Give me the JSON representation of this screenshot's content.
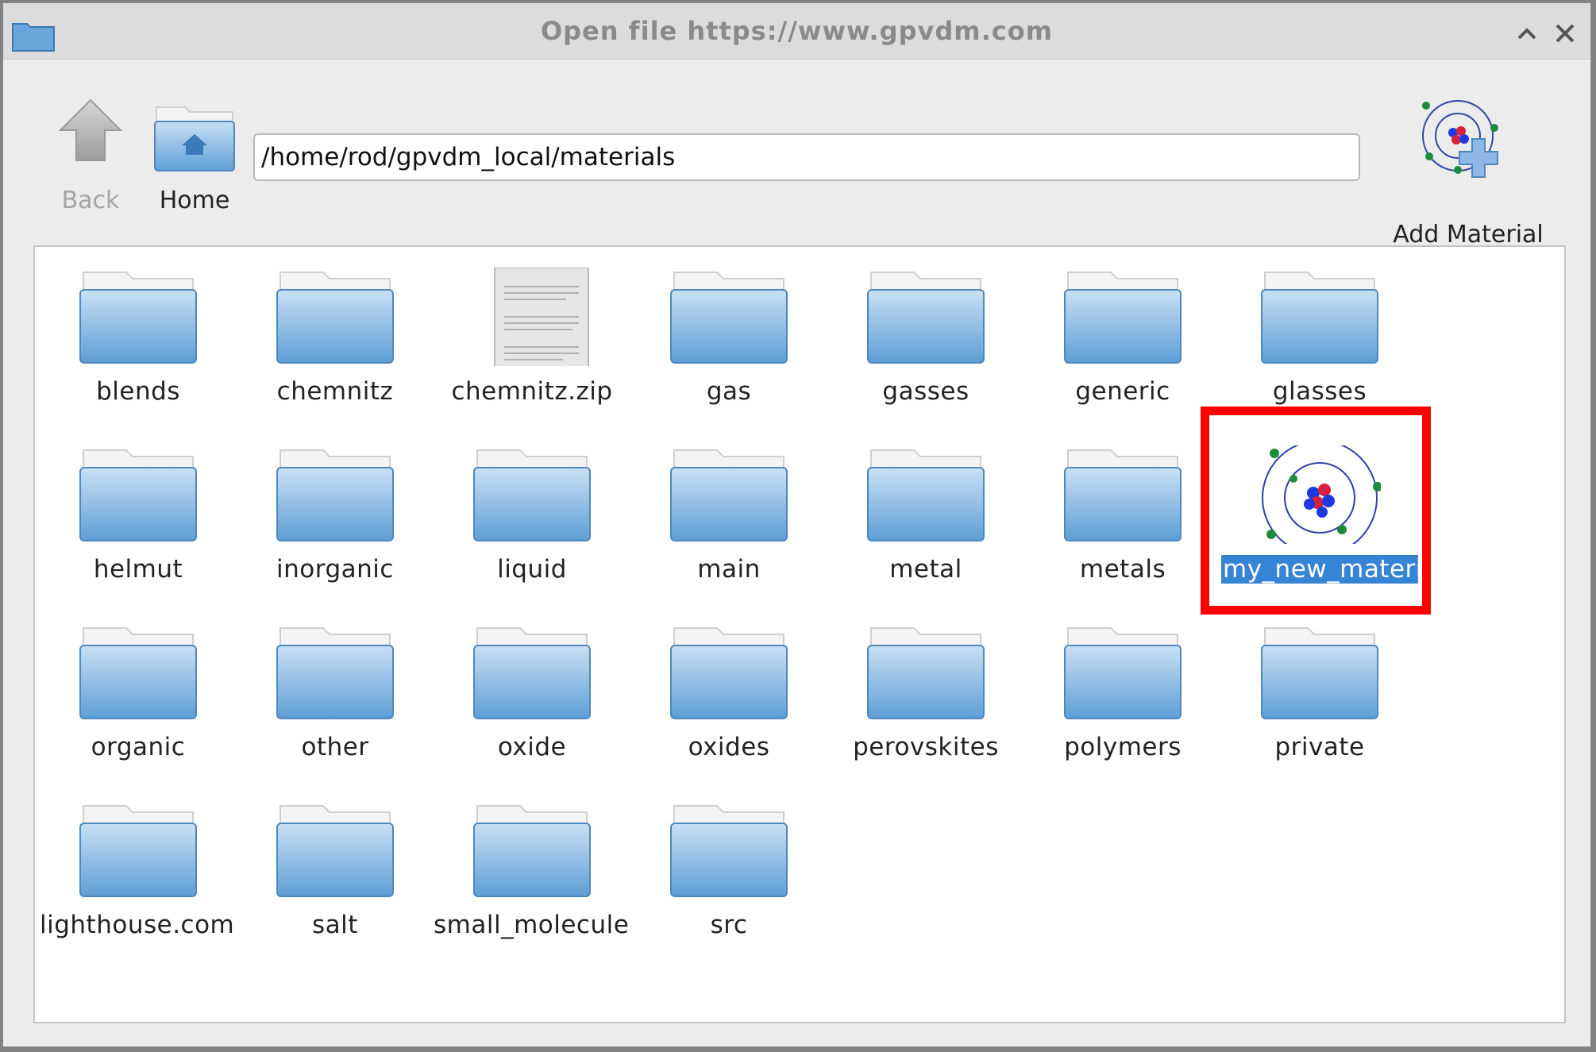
{
  "window": {
    "title": "Open file https://www.gpvdm.com"
  },
  "toolbar": {
    "back_label": "Back",
    "home_label": "Home",
    "path_value": "/home/rod/gpvdm_local/materials",
    "add_material_label": "Add Material"
  },
  "files": [
    {
      "name": "blends",
      "type": "folder"
    },
    {
      "name": "chemnitz",
      "type": "folder"
    },
    {
      "name": "chemnitz.zip",
      "type": "document"
    },
    {
      "name": "gas",
      "type": "folder"
    },
    {
      "name": "gasses",
      "type": "folder"
    },
    {
      "name": "generic",
      "type": "folder"
    },
    {
      "name": "glasses",
      "type": "folder"
    },
    {
      "name": "helmut",
      "type": "folder"
    },
    {
      "name": "inorganic",
      "type": "folder"
    },
    {
      "name": "liquid",
      "type": "folder"
    },
    {
      "name": "main",
      "type": "folder"
    },
    {
      "name": "metal",
      "type": "folder"
    },
    {
      "name": "metals",
      "type": "folder"
    },
    {
      "name": "my_new_material",
      "type": "material",
      "selected": true
    },
    {
      "name": "organic",
      "type": "folder"
    },
    {
      "name": "other",
      "type": "folder"
    },
    {
      "name": "oxide",
      "type": "folder"
    },
    {
      "name": "oxides",
      "type": "folder"
    },
    {
      "name": "perovskites",
      "type": "folder"
    },
    {
      "name": "polymers",
      "type": "folder"
    },
    {
      "name": "private",
      "type": "folder"
    },
    {
      "name": "lighthouse.com.",
      "type": "folder"
    },
    {
      "name": "salt",
      "type": "folder"
    },
    {
      "name": "small_molecules",
      "type": "folder"
    },
    {
      "name": "src",
      "type": "folder"
    }
  ],
  "colors": {
    "selection": "#3584d6",
    "highlight": "#ff0000",
    "folder": "#8bbbe6"
  }
}
